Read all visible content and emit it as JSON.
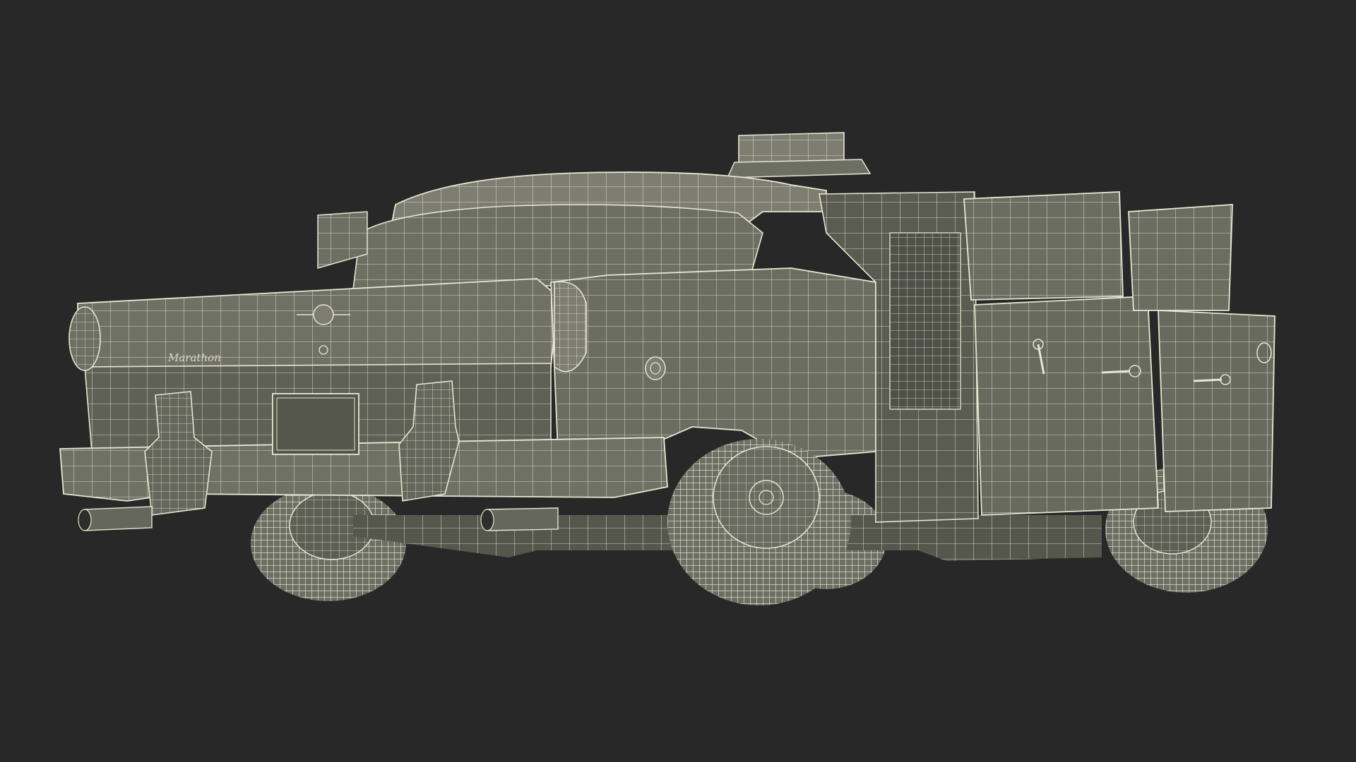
{
  "scene": {
    "background": "#282828",
    "body_fill": "#6e6f63",
    "body_fill_light": "#7d7e71",
    "body_fill_dark": "#55564c",
    "wire_color": "#e6e6d2",
    "subject": "wireframe-taxi-model"
  },
  "emblem": {
    "text": "Marathon"
  }
}
